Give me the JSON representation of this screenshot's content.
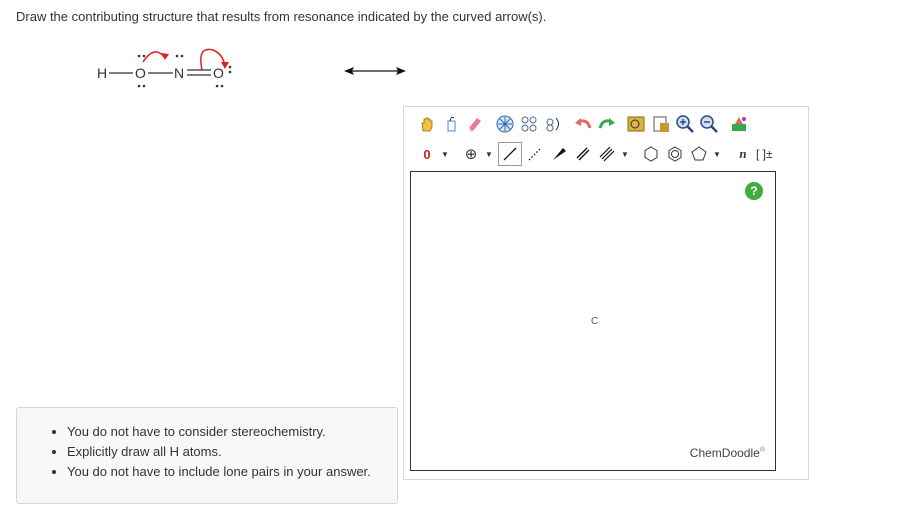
{
  "question": "Draw the contributing structure that results from resonance indicated by the curved arrow(s).",
  "molecule": {
    "h": "H",
    "o1": "O",
    "n": "N",
    "o2": "O"
  },
  "toolbar": {
    "charge_value": "0",
    "charge_plus": "⊕",
    "text_n": "n",
    "bracket": "[ ]±"
  },
  "canvas": {
    "atom_label": "C",
    "help": "?",
    "brand": "ChemDoodle",
    "brand_mark": "®"
  },
  "notes": {
    "items": [
      "You do not have to consider stereochemistry.",
      "Explicitly draw all H atoms.",
      "You do not have to include lone pairs in your answer."
    ]
  },
  "colors": {
    "arrow_red": "#e02020",
    "help_green": "#3fae3f"
  }
}
